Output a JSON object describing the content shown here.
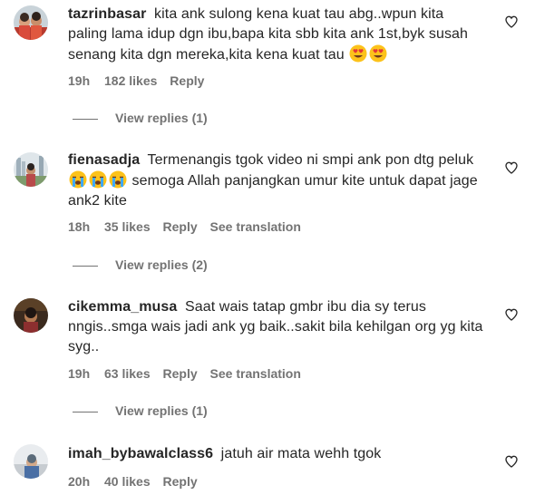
{
  "comments": [
    {
      "username": "tazrinbasar",
      "text": "kita ank sulong kena kuat tau abg..wpun kita paling lama idup dgn ibu,bapa kita sbb kita ank 1st,byk susah senang kita dgn mereka,kita kena kuat tau",
      "emojis": [
        "heart-eyes-emoji",
        "heart-eyes-emoji"
      ],
      "time": "19h",
      "likes": "182 likes",
      "reply": "Reply",
      "replies": "View replies (1)",
      "heart_icon": "heart-outline-icon"
    },
    {
      "username": "fienasadja",
      "text_before": "Termenangis tgok video ni smpi ank pon dtg peluk",
      "emojis": [
        "crying-emoji",
        "crying-emoji",
        "crying-emoji"
      ],
      "text_after": "semoga Allah panjangkan umur kite untuk dapat jage ank2 kite",
      "time": "18h",
      "likes": "35 likes",
      "reply": "Reply",
      "translation": "See translation",
      "replies": "View replies (2)",
      "heart_icon": "heart-outline-icon"
    },
    {
      "username": "cikemma_musa",
      "text": "Saat wais tatap gmbr ibu dia sy terus nngis..smga wais jadi ank yg baik..sakit bila kehilgan org yg kita syg..",
      "time": "19h",
      "likes": "63 likes",
      "reply": "Reply",
      "translation": "See translation",
      "replies": "View replies (1)",
      "heart_icon": "heart-outline-icon"
    },
    {
      "username": "imah_bybawalclass6",
      "text": "jatuh air mata wehh tgok",
      "time": "20h",
      "likes": "40 likes",
      "reply": "Reply",
      "heart_icon": "heart-outline-icon"
    }
  ],
  "colors": {
    "text": "#262626",
    "secondary": "#737373",
    "background": "#ffffff"
  }
}
